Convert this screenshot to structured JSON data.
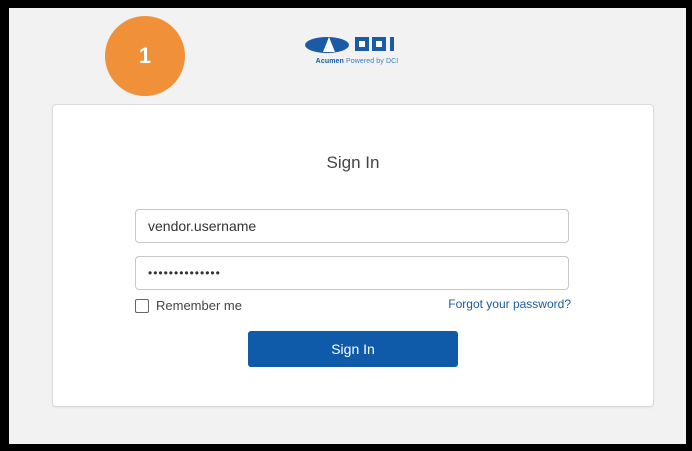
{
  "step_badge": "1",
  "brand": {
    "logo_name": "DCI",
    "tagline_brand": "Acumen",
    "tagline_rest": "Powered by DCI",
    "colors": {
      "primary": "#0f5aa9",
      "accent": "#f0913a"
    }
  },
  "form": {
    "title": "Sign In",
    "username_value": "vendor.username",
    "password_value": "••••••••••••••",
    "remember_label": "Remember me",
    "forgot_label": "Forgot your password?",
    "submit_label": "Sign In"
  }
}
